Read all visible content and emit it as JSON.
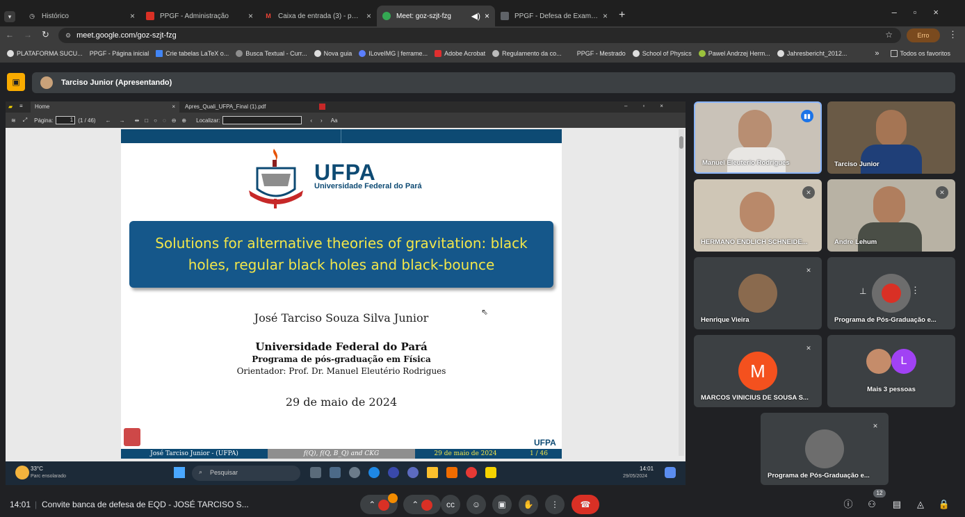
{
  "browser": {
    "tabs": [
      {
        "title": "Histórico",
        "color": "#8ab4f8"
      },
      {
        "title": "PPGF - Administração",
        "color": "#f28b82"
      },
      {
        "title": "Caixa de entrada (3) - ppgf@ufpa",
        "color": "#ea4335"
      },
      {
        "title": "Meet: goz-szjt-fzg",
        "color": "#34a853"
      },
      {
        "title": "PPGF - Defesa de Exame de Qualif",
        "color": "#5f6368"
      }
    ],
    "url": "meet.google.com/goz-szjt-fzg",
    "error_badge": "Erro",
    "bookmarks": [
      "PLATAFORMA SUCU...",
      "PPGF - Página inicial",
      "Crie tabelas LaTeX o...",
      "Busca Textual - Curr...",
      "Nova guia",
      "ILoveIMG | ferrame...",
      "Adobe Acrobat",
      "Regulamento da co...",
      "PPGF - Mestrado",
      "School of Physics",
      "Pawel Andrzej Herm...",
      "Jahresbericht_2012..."
    ],
    "bookmarks_all": "Todos os favoritos"
  },
  "meet": {
    "presenter_banner": "Tarciso Junior (Apresentando)",
    "participants": [
      {
        "name": "Manuel Eleuterio Rodrigues"
      },
      {
        "name": "Tarciso Junior"
      },
      {
        "name": "HERMANO ENDLICH SCHNEIDE..."
      },
      {
        "name": "Andre Lehum"
      },
      {
        "name": "Henrique Vieira"
      },
      {
        "name": "Programa de Pós-Graduação e..."
      },
      {
        "name": "MARCOS VINICIUS DE SOUSA S...",
        "initial": "M"
      },
      {
        "name": "Mais 3 pessoas",
        "initial": "L"
      },
      {
        "name": "Programa de Pós-Graduação e..."
      }
    ],
    "clock": "14:01",
    "meeting_title": "Convite banca de defesa de EQD - JOSÉ TARCISO S...",
    "participant_count": "12"
  },
  "pdf": {
    "tab_home": "Home",
    "tab_file": "Apres_Quali_UFPA_Final (1).pdf",
    "page_label": "Página:",
    "page_value": "1",
    "page_total": "(1 / 46)",
    "find_label": "Localizar:"
  },
  "slide": {
    "logo_text": "UFPA",
    "logo_sub": "Universidade Federal do Pará",
    "title": "Solutions for alternative theories of gravitation: black holes, regular black holes and black-bounce",
    "author": "José Tarciso Souza Silva Junior",
    "institution": "Universidade Federal do Pará",
    "program": "Programa de pós-graduação em Física",
    "advisor": "Orientador: Prof. Dr. Manuel Eleutério Rodrigues",
    "date": "29 de maio de 2024",
    "corner_logo": "UFPA",
    "footer": [
      "José Tarciso Junior - (UFPA)",
      "f(Q), f(Q, B_Q) and CKG",
      "29 de maio de 2024",
      "1 / 46"
    ]
  },
  "taskbar": {
    "temp": "33°C",
    "weather": "Parc ensolarado",
    "search": "Pesquisar",
    "time": "14:01",
    "date": "29/05/2024"
  }
}
